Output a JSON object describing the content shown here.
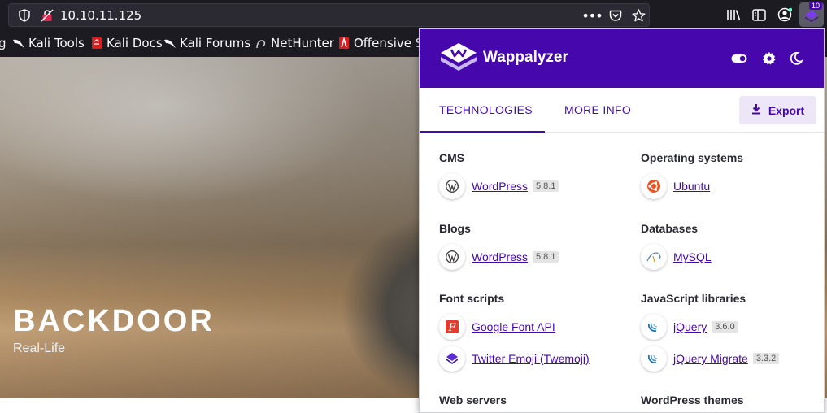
{
  "browser": {
    "url": "10.10.11.125",
    "extension_badge": "10",
    "bookmarks": [
      {
        "label": "Kali Tools",
        "icon": "kali-dragon-icon"
      },
      {
        "label": "Kali Docs",
        "icon": "kali-docs-icon"
      },
      {
        "label": "Kali Forums",
        "icon": "kali-dragon-icon"
      },
      {
        "label": "NetHunter",
        "icon": "nethunter-icon"
      },
      {
        "label": "Offensive Se",
        "icon": "offsec-icon"
      }
    ],
    "bookmark_partial": "g"
  },
  "site": {
    "title": "BACKDOOR",
    "subtitle": "Real-Life"
  },
  "wappalyzer": {
    "brand": "Wappalyzer",
    "accent": "#4608ad",
    "tabs": [
      "TECHNOLOGIES",
      "MORE INFO"
    ],
    "export_label": "Export",
    "categories": [
      {
        "name": "CMS",
        "items": [
          {
            "name": "WordPress",
            "version": "5.8.1",
            "icon": "wordpress-icon"
          }
        ]
      },
      {
        "name": "Operating systems",
        "items": [
          {
            "name": "Ubuntu",
            "version": "",
            "icon": "ubuntu-icon"
          }
        ]
      },
      {
        "name": "Blogs",
        "items": [
          {
            "name": "WordPress",
            "version": "5.8.1",
            "icon": "wordpress-icon"
          }
        ]
      },
      {
        "name": "Databases",
        "items": [
          {
            "name": "MySQL",
            "version": "",
            "icon": "mysql-icon"
          }
        ]
      },
      {
        "name": "Font scripts",
        "items": [
          {
            "name": "Google Font API",
            "version": "",
            "icon": "google-font-icon"
          },
          {
            "name": "Twitter Emoji (Twemoji)",
            "version": "",
            "icon": "twemoji-icon"
          }
        ]
      },
      {
        "name": "JavaScript libraries",
        "items": [
          {
            "name": "jQuery",
            "version": "3.6.0",
            "icon": "jquery-icon"
          },
          {
            "name": "jQuery Migrate",
            "version": "3.3.2",
            "icon": "jquery-icon"
          }
        ]
      },
      {
        "name": "Web servers",
        "items": []
      },
      {
        "name": "WordPress themes",
        "items": []
      }
    ]
  }
}
